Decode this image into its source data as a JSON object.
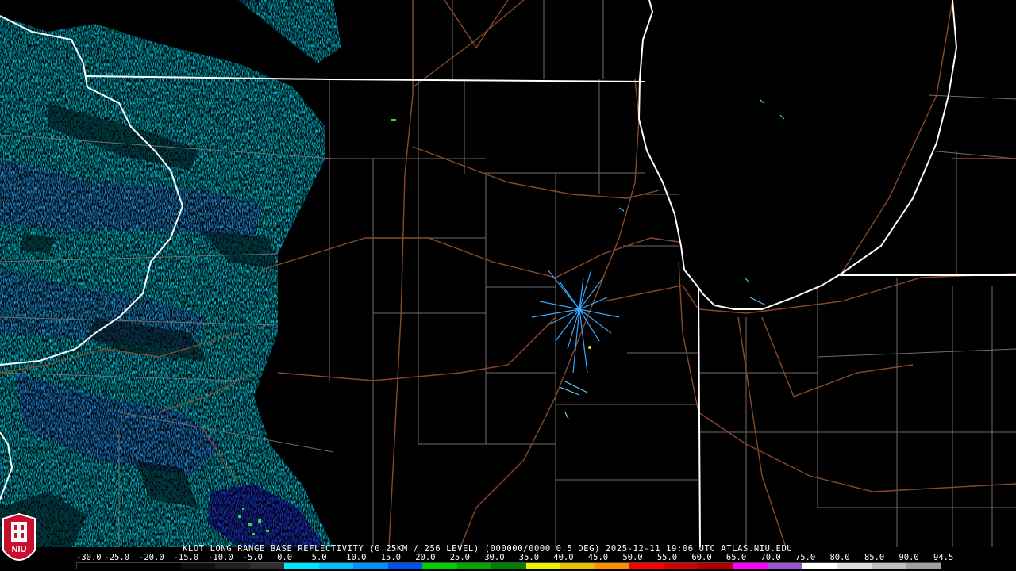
{
  "caption": "KLOT LONG RANGE BASE REFLECTIVITY (0.25KM / 256 LEVEL) (000000/0000 0.5 DEG) 2025-12-11 19:06 UTC  ATLAS.NIU.EDU",
  "scale": {
    "labels": [
      "-30.0",
      "-25.0",
      "-20.0",
      "-15.0",
      "-10.0",
      "-5.0",
      "0.0",
      "5.0",
      "10.0",
      "15.0",
      "20.0",
      "25.0",
      "30.0",
      "35.0",
      "40.0",
      "45.0",
      "50.0",
      "55.0",
      "60.0",
      "65.0",
      "70.0",
      "75.0",
      "80.0",
      "85.0",
      "90.0",
      "94.5"
    ],
    "colors": [
      "#000000",
      "#000000",
      "#000000",
      "#101010",
      "#202020",
      "#303030",
      "#00e5ff",
      "#00c0ff",
      "#0090ff",
      "#0050f0",
      "#00d000",
      "#00a800",
      "#008000",
      "#f0f000",
      "#e8c000",
      "#ff9000",
      "#ff0000",
      "#d00000",
      "#b00000",
      "#ff00ff",
      "#9955cc",
      "#ffffff",
      "#e0e0e0",
      "#c0c0c0",
      "#a0a0a0"
    ]
  },
  "logo": {
    "text": "NIU",
    "colors": {
      "background": "#c8102e",
      "text": "#ffffff"
    }
  },
  "colors": {
    "background": "#000000",
    "state_lines": "#ffffff",
    "highways": "#8a4a2a",
    "counties": "#777777",
    "echo_light": "#00e5ff",
    "echo_mid": "#1ea0ff",
    "echo_dark": "#1e3cf0",
    "echo_green": "#20d040"
  }
}
